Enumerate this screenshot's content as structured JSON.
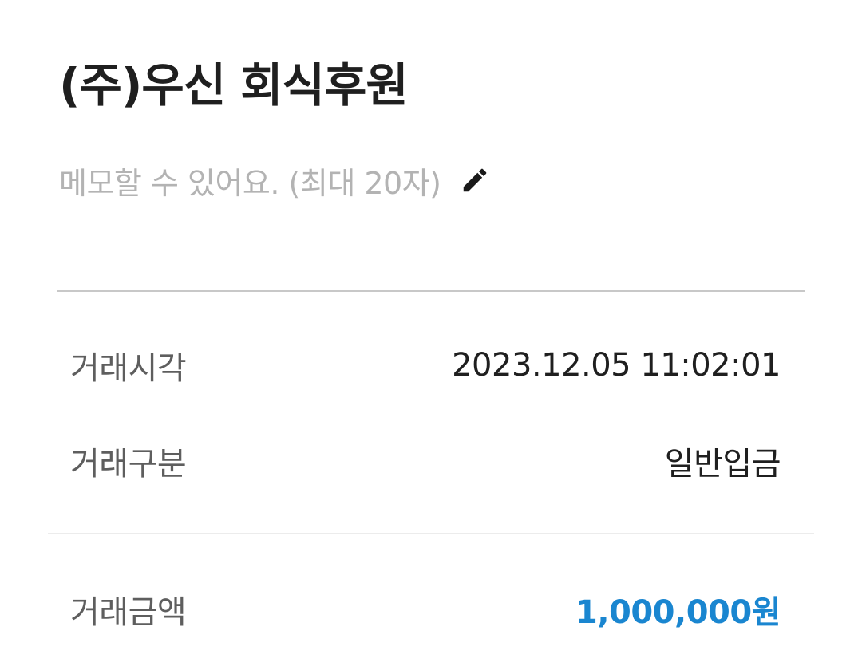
{
  "header": {
    "title": "(주)우신 회식후원"
  },
  "memo": {
    "placeholder": "메모할 수 있어요. (최대 20자)",
    "edit_icon": "pencil-icon"
  },
  "details": {
    "time_label": "거래시각",
    "time_value": "2023.12.05 11:02:01",
    "type_label": "거래구분",
    "type_value": "일반입금",
    "amount_label": "거래금액",
    "amount_value": "1,000,000원"
  },
  "colors": {
    "amount": "#1a86d0",
    "memo_placeholder": "#b3b3b3",
    "label": "#5e5e5e"
  }
}
